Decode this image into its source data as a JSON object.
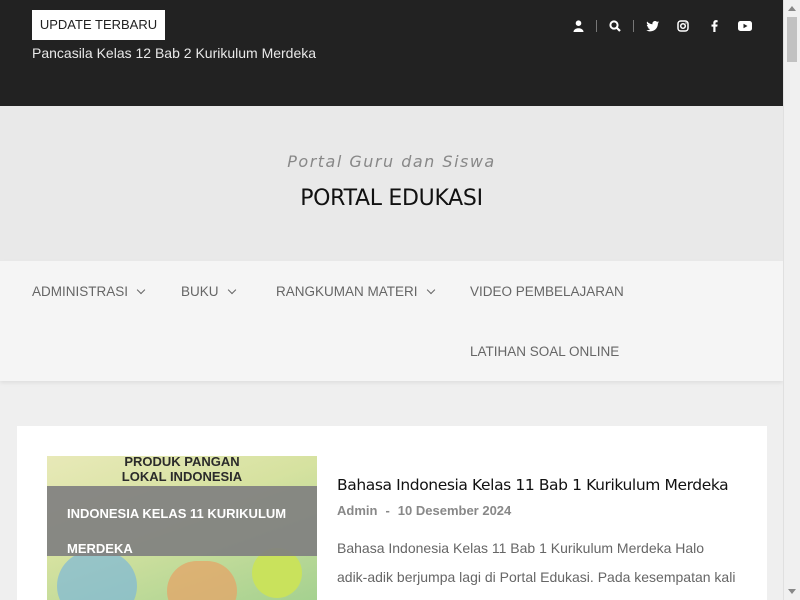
{
  "topbar": {
    "badge_label": "UPDATE TERBARU",
    "ticker_text": "Pancasila Kelas 12 Bab 2 Kurikulum Merdeka",
    "icons": [
      "user-icon",
      "search-icon",
      "twitter-icon",
      "instagram-icon",
      "facebook-icon",
      "youtube-icon"
    ]
  },
  "header": {
    "tagline": "Portal Guru dan Siswa",
    "site_title": "PORTAL EDUKASI"
  },
  "nav": {
    "items": [
      {
        "label": "ADMINISTRASI",
        "has_dropdown": true
      },
      {
        "label": "BUKU",
        "has_dropdown": true
      },
      {
        "label": "RANGKUMAN MATERI",
        "has_dropdown": true
      },
      {
        "label": "VIDEO PEMBELAJARAN",
        "has_dropdown": false
      },
      {
        "label": "LATIHAN SOAL ONLINE",
        "has_dropdown": false
      }
    ]
  },
  "post": {
    "thumb_text_line1": "PRODUK PANGAN",
    "thumb_text_line2": "LOKAL INDONESIA",
    "category_line1": "INDONESIA KELAS 11 KURIKULUM",
    "category_line2": "MERDEKA",
    "title": "Bahasa Indonesia Kelas 11 Bab 1 Kurikulum Merdeka",
    "author": "Admin",
    "date": "10 Desember 2024",
    "excerpt": "Bahasa Indonesia Kelas 11 Bab 1 Kurikulum Merdeka Halo adik-adik berjumpa lagi di Portal Edukasi. Pada kesempatan kali ini Admin akan membagikan materi bermanfaat"
  },
  "colors": {
    "topbar_bg": "#222222",
    "header_bg": "#e9e9e9",
    "nav_bg": "#f5f5f5",
    "category_bg": "#808080"
  }
}
